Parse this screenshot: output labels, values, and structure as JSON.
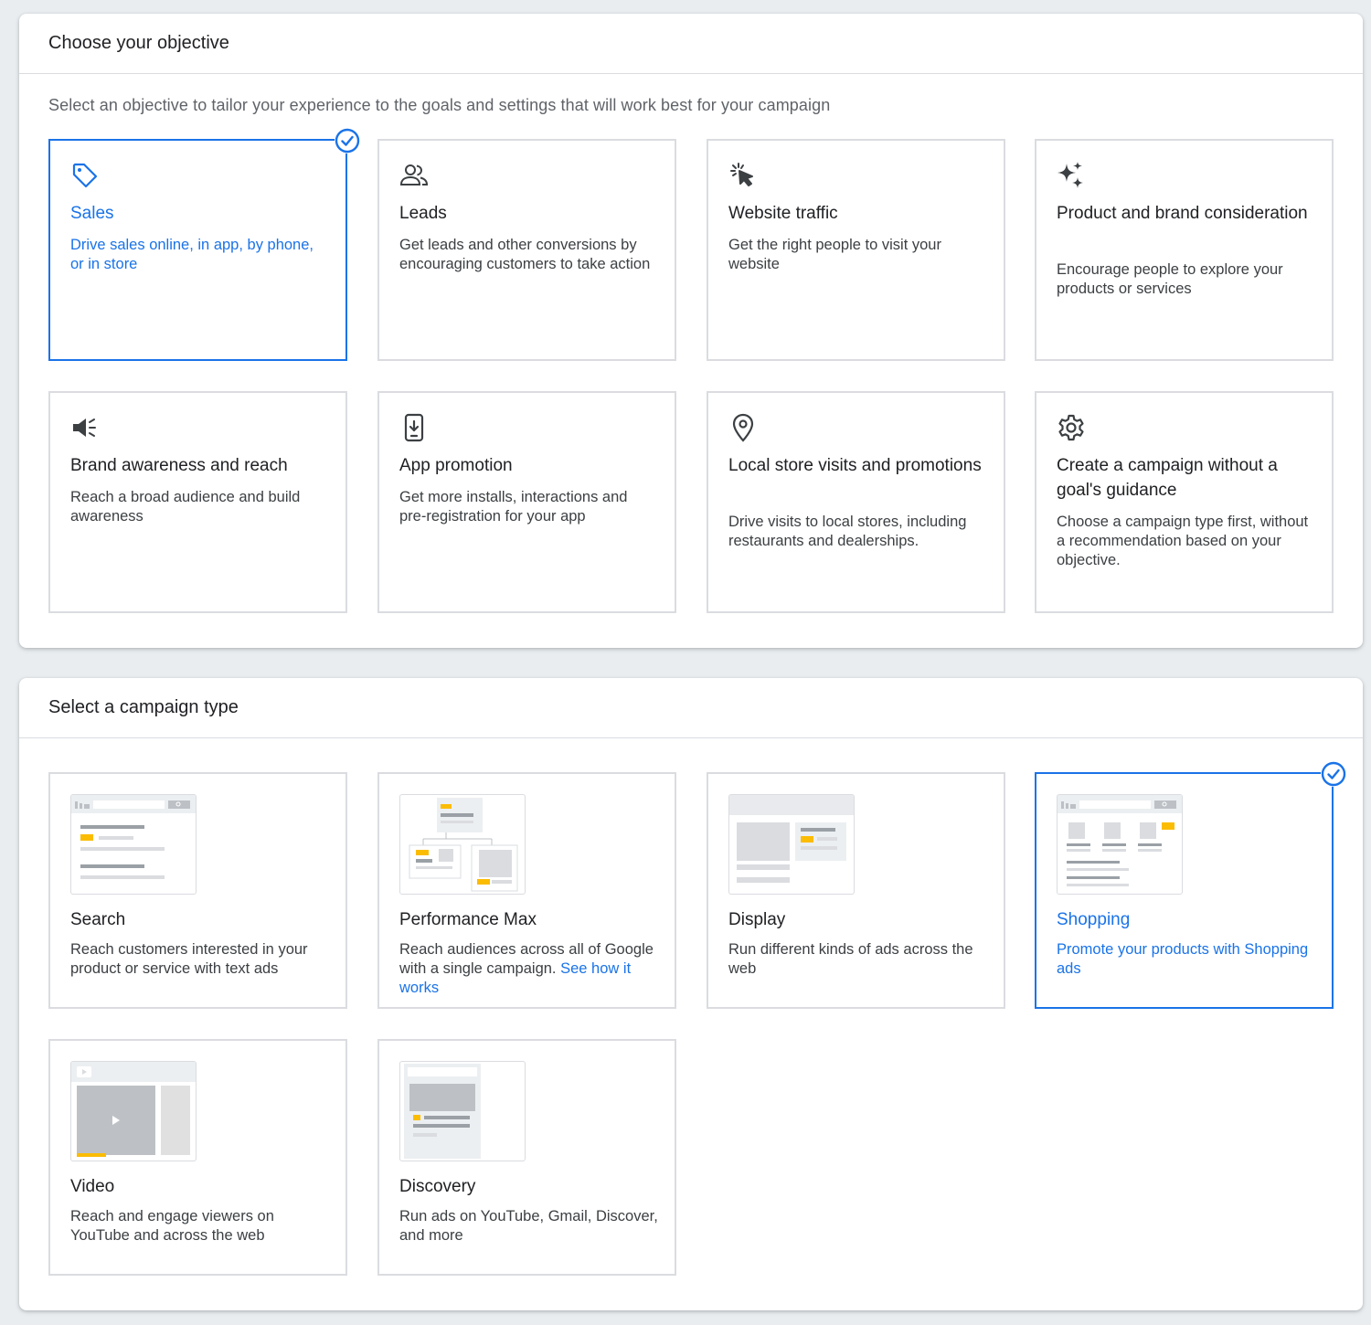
{
  "objective": {
    "title": "Choose your objective",
    "subtitle": "Select an objective to tailor your experience to the goals and settings that will work best for your campaign",
    "cards": [
      {
        "icon": "tag-icon",
        "title": "Sales",
        "description": "Drive sales online, in app, by phone, or in store",
        "selected": true
      },
      {
        "icon": "people-icon",
        "title": "Leads",
        "description": "Get leads and other conversions by encouraging customers to take action",
        "selected": false
      },
      {
        "icon": "cursor-click-icon",
        "title": "Website traffic",
        "description": "Get the right people to visit your website",
        "selected": false
      },
      {
        "icon": "sparkle-icon",
        "title": "Product and brand consideration",
        "description": "Encourage people to explore your products or services",
        "selected": false
      },
      {
        "icon": "megaphone-icon",
        "title": "Brand awareness and reach",
        "description": "Reach a broad audience and build awareness",
        "selected": false
      },
      {
        "icon": "phone-download-icon",
        "title": "App promotion",
        "description": "Get more installs, interactions and pre-registration for your app",
        "selected": false
      },
      {
        "icon": "location-pin-icon",
        "title": "Local store visits and promotions",
        "description": "Drive visits to local stores, including restaurants and dealerships.",
        "selected": false
      },
      {
        "icon": "gear-icon",
        "title": "Create a campaign without a goal's guidance",
        "description": "Choose a campaign type first, without a recommendation based on your objective.",
        "selected": false
      }
    ]
  },
  "campaign_type": {
    "title": "Select a campaign type",
    "cards": [
      {
        "thumbnail": "search-thumbnail",
        "title": "Search",
        "description": "Reach customers interested in your product or service with text ads",
        "selected": false
      },
      {
        "thumbnail": "performance-max-thumbnail",
        "title": "Performance Max",
        "description": "Reach audiences across all of Google with a single campaign.",
        "link": "See how it works",
        "selected": false
      },
      {
        "thumbnail": "display-thumbnail",
        "title": "Display",
        "description": "Run different kinds of ads across the web",
        "selected": false
      },
      {
        "thumbnail": "shopping-thumbnail",
        "title": "Shopping",
        "description": "Promote your products with Shopping ads",
        "selected": true
      },
      {
        "thumbnail": "video-thumbnail",
        "title": "Video",
        "description": "Reach and engage viewers on YouTube and across the web",
        "selected": false
      },
      {
        "thumbnail": "discovery-thumbnail",
        "title": "Discovery",
        "description": "Run ads on YouTube, Gmail, Discover, and more",
        "selected": false
      }
    ]
  },
  "colors": {
    "accent": "#1a73e8",
    "card_border": "#dadce0",
    "thumbnail_highlight": "#fbbc04",
    "thumbnail_gray": "#dadce0"
  }
}
